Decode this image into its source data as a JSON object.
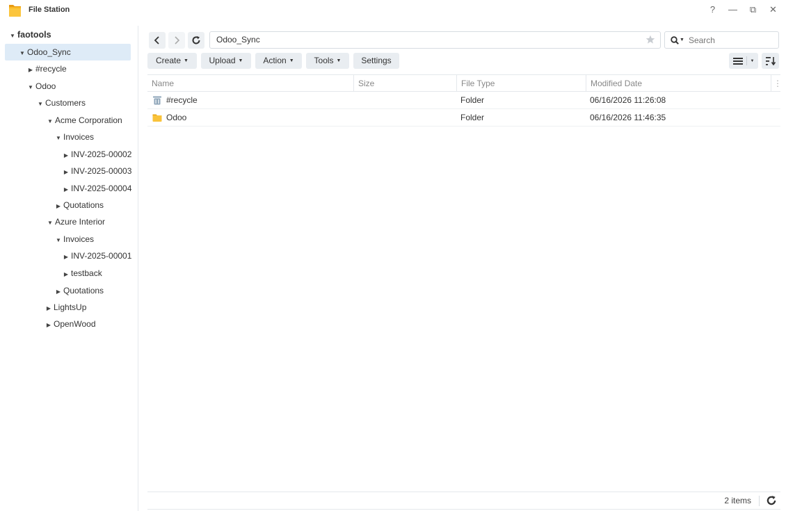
{
  "app": {
    "title": "File Station",
    "icon": "folder-icon"
  },
  "window_controls": {
    "help": "?",
    "minimize": "—",
    "restore": "⧉",
    "close": "✕"
  },
  "sidebar": {
    "items": [
      {
        "label": "faotools",
        "expanded": true
      },
      {
        "label": "Odoo_Sync",
        "expanded": true,
        "selected": true
      },
      {
        "label": "#recycle",
        "expanded": false
      },
      {
        "label": "Odoo",
        "expanded": true
      },
      {
        "label": "Customers",
        "expanded": true
      },
      {
        "label": "Acme Corporation",
        "expanded": true
      },
      {
        "label": "Invoices",
        "expanded": true
      },
      {
        "label": "INV-2025-00002",
        "expanded": false
      },
      {
        "label": "INV-2025-00003",
        "expanded": false
      },
      {
        "label": "INV-2025-00004",
        "expanded": false
      },
      {
        "label": "Quotations",
        "expanded": false
      },
      {
        "label": "Azure Interior",
        "expanded": true
      },
      {
        "label": "Invoices",
        "expanded": true
      },
      {
        "label": "INV-2025-00001",
        "expanded": false
      },
      {
        "label": "testback",
        "expanded": false
      },
      {
        "label": "Quotations",
        "expanded": false
      },
      {
        "label": "LightsUp",
        "expanded": false
      },
      {
        "label": "OpenWood",
        "expanded": false
      }
    ]
  },
  "navbar": {
    "path": "Odoo_Sync",
    "search_placeholder": "Search"
  },
  "toolbar": {
    "create": "Create",
    "upload": "Upload",
    "action": "Action",
    "tools": "Tools",
    "settings": "Settings"
  },
  "table": {
    "columns": [
      "Name",
      "Size",
      "File Type",
      "Modified Date"
    ],
    "rows": [
      {
        "name": "#recycle",
        "size": "",
        "type": "Folder",
        "modified": "06/16/2026 11:26:08",
        "icon": "recycle-bin-icon"
      },
      {
        "name": "Odoo",
        "size": "",
        "type": "Folder",
        "modified": "06/16/2026 11:46:35",
        "icon": "folder-icon"
      }
    ]
  },
  "footer": {
    "count": "2 items"
  },
  "colors": {
    "selected_bg": "#deebf7",
    "folder": "#f9c33b",
    "button_bg": "#e9edf1",
    "border": "#e4e8ec"
  }
}
